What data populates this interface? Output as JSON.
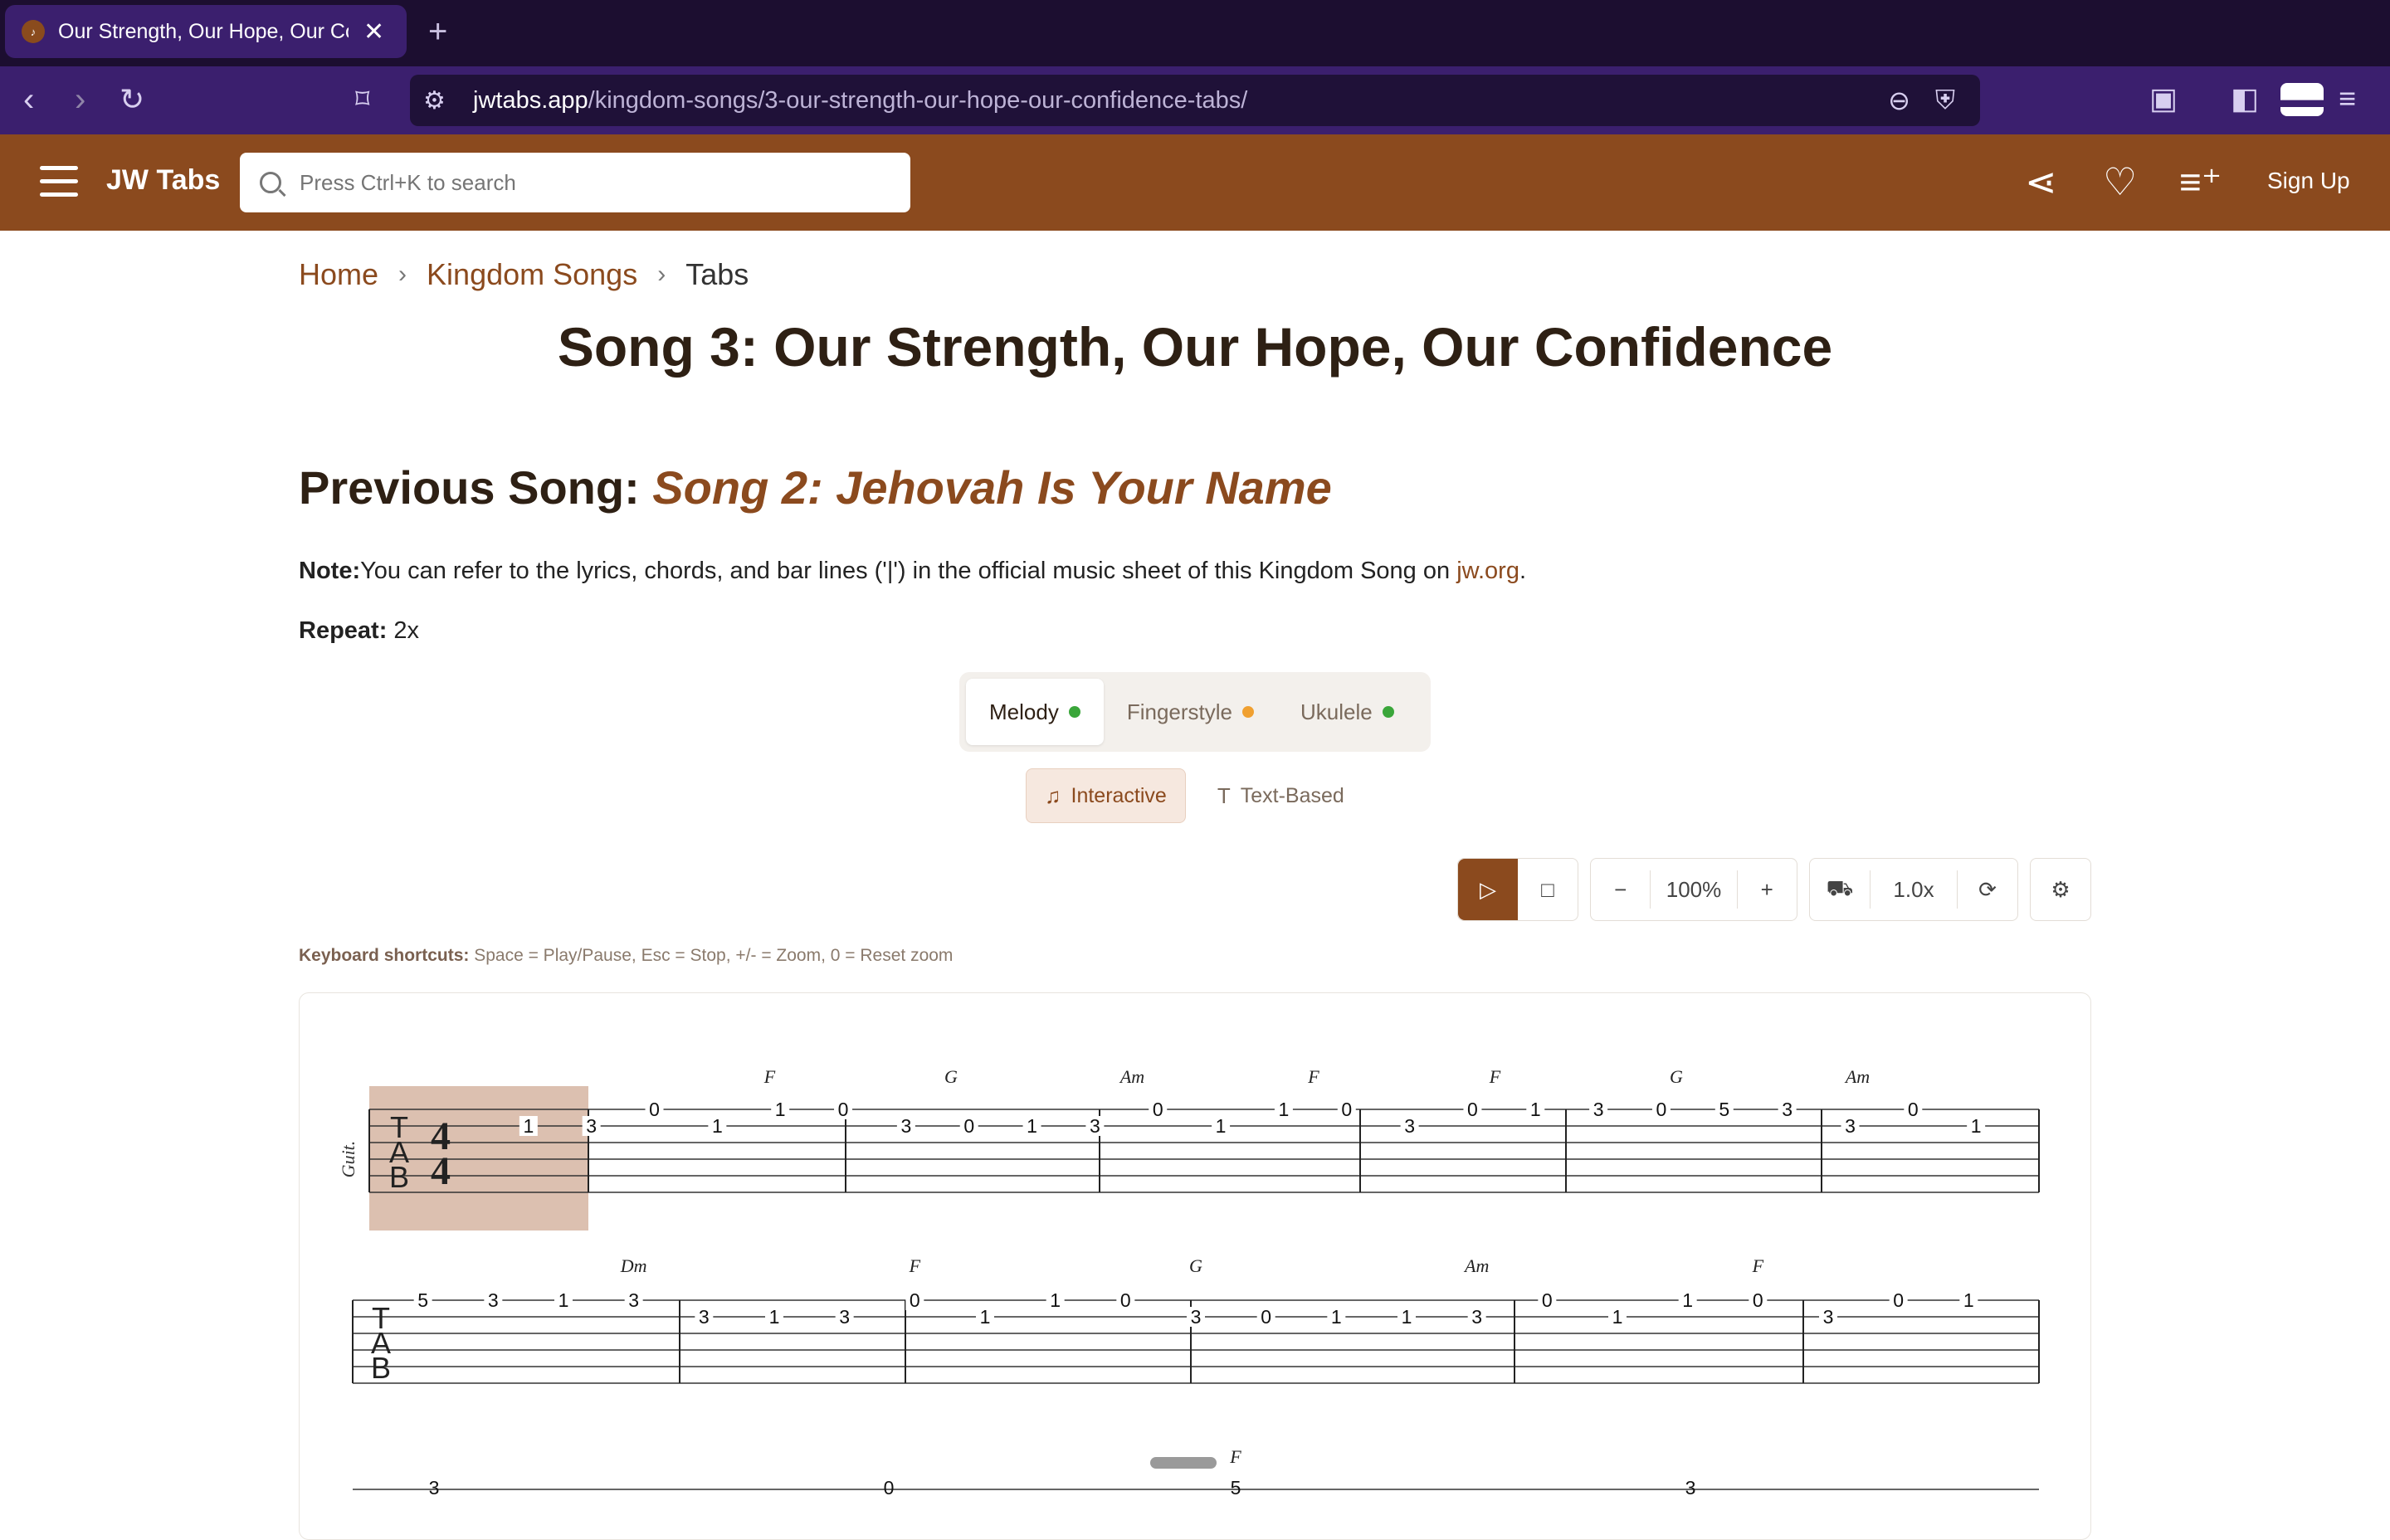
{
  "browser": {
    "tab_title": "Our Strength, Our Hope, Our Confidence",
    "tab_close": "✕",
    "new_tab": "+",
    "url_host": "jwtabs.app",
    "url_path": "/kingdom-songs/3-our-strength-our-hope-our-confidence-tabs/"
  },
  "header": {
    "brand": "JW Tabs",
    "search_placeholder": "Press Ctrl+K to search",
    "signup": "Sign Up"
  },
  "breadcrumb": {
    "home": "Home",
    "section": "Kingdom Songs",
    "current": "Tabs",
    "sep": "›"
  },
  "page": {
    "title": "Song 3: Our Strength, Our Hope, Our Confidence",
    "prev_label": "Previous Song: ",
    "prev_song": "Song 2: Jehovah Is Your Name",
    "note_label": "Note:",
    "note_text": "You can refer to the lyrics, chords, and bar lines ('|') in the official music sheet of this Kingdom Song on ",
    "note_link": "jw.org",
    "note_end": ".",
    "repeat_label": "Repeat:",
    "repeat_value": " 2x"
  },
  "arrangements": [
    {
      "label": "Melody",
      "dot": "#3aa63a"
    },
    {
      "label": "Fingerstyle",
      "dot": "#f0a030"
    },
    {
      "label": "Ukulele",
      "dot": "#3aa63a"
    }
  ],
  "modes": {
    "interactive": "Interactive",
    "text": "Text-Based"
  },
  "controls": {
    "zoom": "100%",
    "speed": "1.0x"
  },
  "shortcuts": {
    "label": "Keyboard shortcuts:",
    "text": " Space = Play/Pause, Esc = Stop, +/- = Zoom, 0 = Reset zoom"
  },
  "score": {
    "instrument": "Guit.",
    "tab_letters": [
      "T",
      "A",
      "B"
    ],
    "time_sig": [
      "4",
      "4"
    ],
    "row1_chords": [
      "F",
      "G",
      "Am",
      "F",
      "F",
      "G",
      "Am"
    ],
    "row1_notes": [
      {
        "s": 2,
        "v": "1"
      },
      {
        "s": 2,
        "v": "3"
      },
      {
        "s": 1,
        "v": "0"
      },
      {
        "s": 2,
        "v": "1"
      },
      {
        "s": 1,
        "v": "1"
      },
      {
        "s": 1,
        "v": "0"
      },
      {
        "s": 2,
        "v": "3"
      },
      {
        "s": 2,
        "v": "0"
      },
      {
        "s": 2,
        "v": "1"
      },
      {
        "s": 2,
        "v": "3"
      },
      {
        "s": 1,
        "v": "0"
      },
      {
        "s": 2,
        "v": "1"
      },
      {
        "s": 1,
        "v": "1"
      },
      {
        "s": 1,
        "v": "0"
      },
      {
        "s": 2,
        "v": "3"
      },
      {
        "s": 1,
        "v": "0"
      },
      {
        "s": 1,
        "v": "1"
      },
      {
        "s": 1,
        "v": "3"
      },
      {
        "s": 1,
        "v": "0"
      },
      {
        "s": 1,
        "v": "5"
      },
      {
        "s": 1,
        "v": "3"
      },
      {
        "s": 2,
        "v": "3"
      },
      {
        "s": 1,
        "v": "0"
      },
      {
        "s": 2,
        "v": "1"
      }
    ],
    "row2_chords": [
      "Dm",
      "F",
      "G",
      "Am",
      "F"
    ],
    "row2_notes": [
      {
        "s": 1,
        "v": "5"
      },
      {
        "s": 1,
        "v": "3"
      },
      {
        "s": 1,
        "v": "1"
      },
      {
        "s": 1,
        "v": "3"
      },
      {
        "s": 2,
        "v": "3"
      },
      {
        "s": 2,
        "v": "1"
      },
      {
        "s": 2,
        "v": "3"
      },
      {
        "s": 1,
        "v": "0"
      },
      {
        "s": 2,
        "v": "1"
      },
      {
        "s": 1,
        "v": "1"
      },
      {
        "s": 1,
        "v": "0"
      },
      {
        "s": 2,
        "v": "3"
      },
      {
        "s": 2,
        "v": "0"
      },
      {
        "s": 2,
        "v": "1"
      },
      {
        "s": 2,
        "v": "1"
      },
      {
        "s": 2,
        "v": "3"
      },
      {
        "s": 1,
        "v": "0"
      },
      {
        "s": 2,
        "v": "1"
      },
      {
        "s": 1,
        "v": "1"
      },
      {
        "s": 1,
        "v": "0"
      },
      {
        "s": 2,
        "v": "3"
      },
      {
        "s": 1,
        "v": "0"
      },
      {
        "s": 1,
        "v": "1"
      }
    ],
    "row3_chords": [
      "F"
    ],
    "row3_notes": [
      {
        "s": 1,
        "v": "3"
      },
      {
        "s": 1,
        "v": "0"
      },
      {
        "s": 1,
        "v": "5"
      },
      {
        "s": 1,
        "v": "3"
      }
    ]
  },
  "colors": {
    "header": "#8b4a1e",
    "accent": "#8b4a1e",
    "chrome": "#3b1f6e"
  }
}
